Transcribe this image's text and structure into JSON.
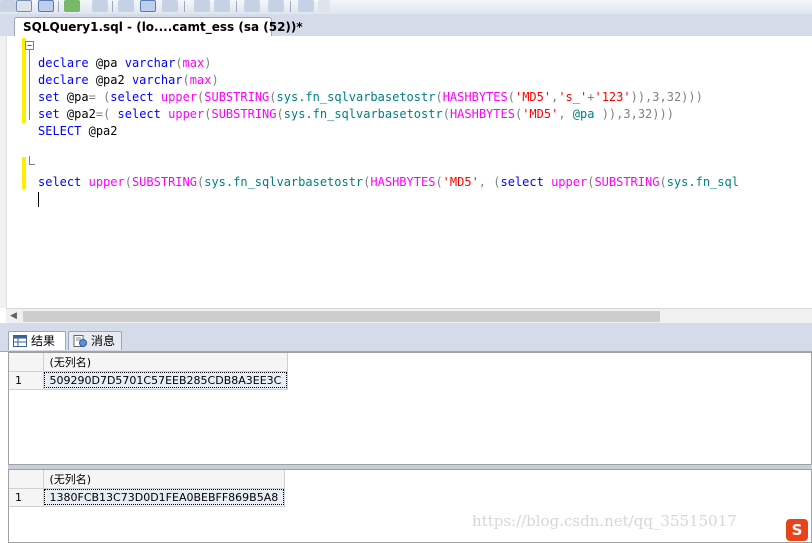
{
  "document_tab": {
    "title": "SQLQuery1.sql - (lo....camt_ess (sa (52))*"
  },
  "editor": {
    "line1": {
      "declare": "declare",
      "var": "@pa",
      "type": "varchar",
      "open": "(",
      "max": "max",
      "close": ")"
    },
    "line2": {
      "declare": "declare",
      "var": "@pa2",
      "type": "varchar",
      "open": "(",
      "max": "max",
      "close": ")"
    },
    "line3": {
      "set": "set",
      "var": "@pa",
      "eq": "=",
      "open": " (",
      "select": "select",
      "upper": "upper",
      "p1": "(",
      "substring": "SUBSTRING",
      "p2": "(",
      "sysfn": "sys.fn_sqlvarbasetostr",
      "p3": "(",
      "hashbytes": "HASHBYTES",
      "p4": "(",
      "md5": "'MD5'",
      "comma": ",",
      "s": "'s_'",
      "plus": "+",
      "n": "'123'",
      "tail": ")),3,32)))"
    },
    "line4": {
      "set": "set",
      "var": "@pa2",
      "eq": "=",
      "open": "(",
      "select": "select",
      "upper": "upper",
      "p1": "(",
      "substring": "SUBSTRING",
      "p2": "(",
      "sysfn": "sys.fn_sqlvarbasetostr",
      "p3": "(",
      "hashbytes": "HASHBYTES",
      "p4": "(",
      "md5": "'MD5'",
      "comma": ", ",
      "var2": "@pa",
      "tail": " )),3,32)))"
    },
    "line5": {
      "select": "SELECT",
      "var": "@pa2"
    },
    "line8": {
      "select": "select",
      "upper": "upper",
      "p1": "(",
      "substring": "SUBSTRING",
      "p2": "(",
      "sysfn": "sys.fn_sqlvarbasetostr",
      "p3": "(",
      "hashbytes": "HASHBYTES",
      "p4": "(",
      "md5": "'MD5'",
      "comma": ", ",
      "p5": "(",
      "select2": "select",
      "upper2": "upper",
      "p6": "(",
      "substring2": "SUBSTRING",
      "p7": "(",
      "sysfn2": "sys.fn_sql"
    }
  },
  "results_tabs": [
    {
      "label": "结果",
      "icon": "grid-icon"
    },
    {
      "label": "消息",
      "icon": "message-icon"
    }
  ],
  "results": [
    {
      "header": "(无列名)",
      "rows": [
        {
          "num": "1",
          "value": "509290D7D5701C57EEB285CDB8A3EE3C"
        }
      ]
    },
    {
      "header": "(无列名)",
      "rows": [
        {
          "num": "1",
          "value": "1380FCB13C73D0D1FEA0BEBFF869B5A8"
        }
      ]
    }
  ],
  "watermark": {
    "text": "https://blog.csdn.net/qq_35515017"
  },
  "logo": {
    "text": "S"
  }
}
